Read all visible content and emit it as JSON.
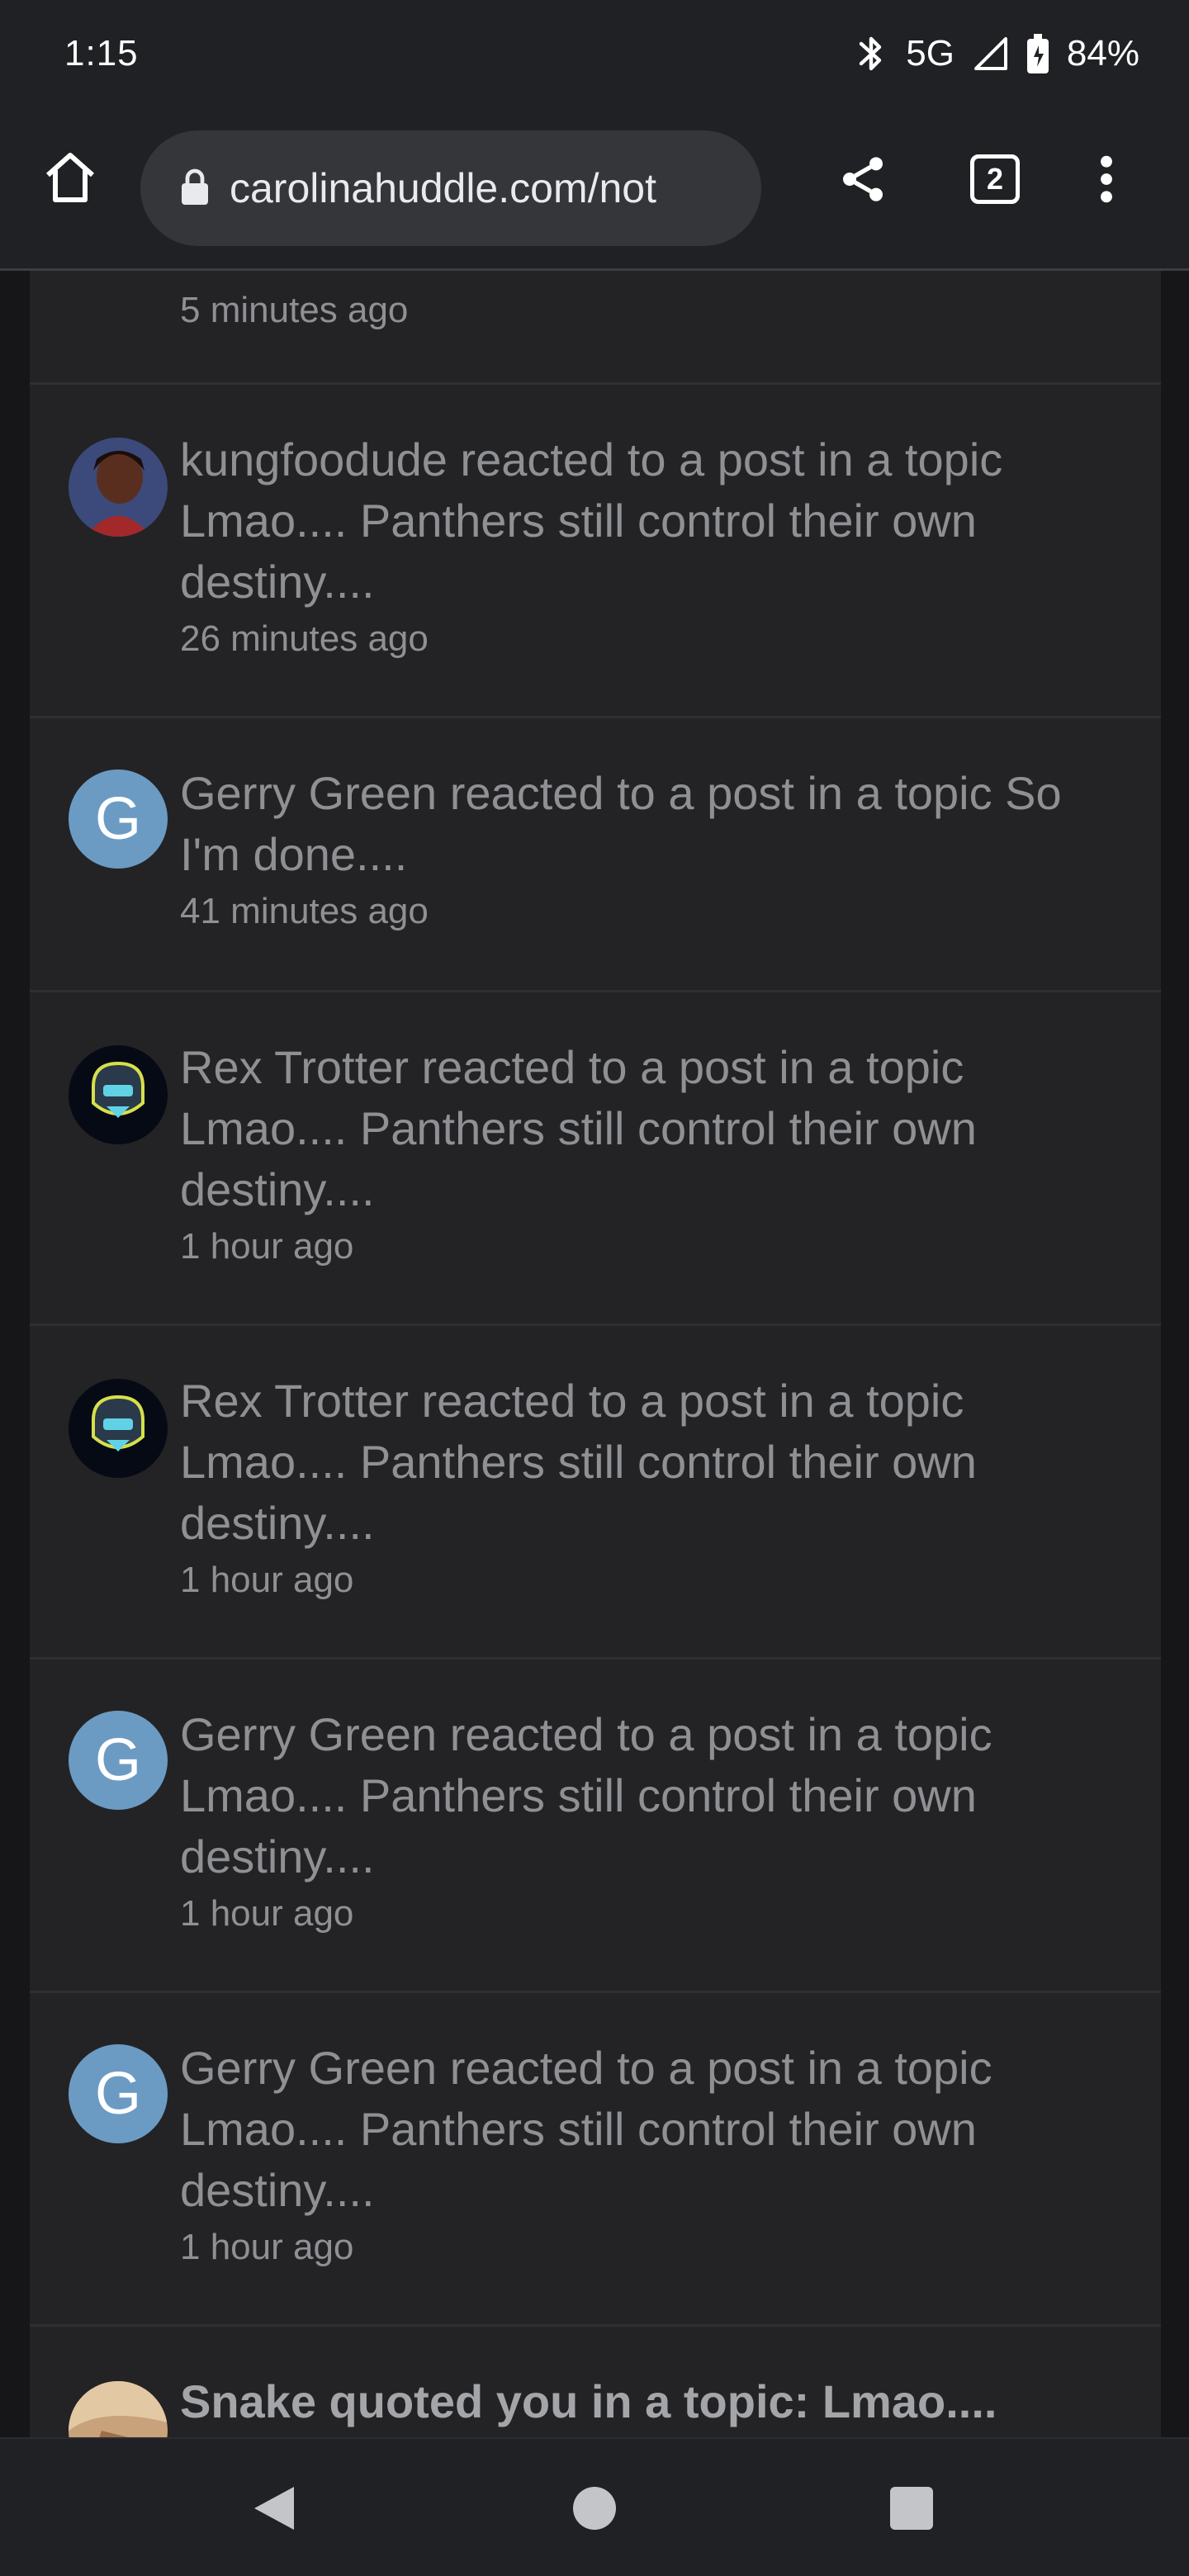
{
  "status_bar": {
    "time": "1:15",
    "network": "5G",
    "battery": "84%"
  },
  "browser": {
    "url": "carolinahuddle.com/not",
    "tab_count": "2"
  },
  "feed": {
    "first_item_time": "5 minutes ago",
    "items": [
      {
        "avatar": "photo",
        "message": "kungfoodude reacted to a post in a topic Lmao.... Panthers still control their own destiny....",
        "time": "26 minutes ago"
      },
      {
        "avatar_letter": "G",
        "message": "Gerry Green reacted to a post in a topic So I'm done....",
        "time": "41 minutes ago"
      },
      {
        "avatar": "robot-logo",
        "message": "Rex Trotter reacted to a post in a topic Lmao.... Panthers still control their own destiny....",
        "time": "1 hour ago"
      },
      {
        "avatar": "robot-logo",
        "message": "Rex Trotter reacted to a post in a topic Lmao.... Panthers still control their own destiny....",
        "time": "1 hour ago"
      },
      {
        "avatar_letter": "G",
        "message": "Gerry Green reacted to a post in a topic Lmao.... Panthers still control their own destiny....",
        "time": "1 hour ago"
      },
      {
        "avatar_letter": "G",
        "message": "Gerry Green reacted to a post in a topic Lmao.... Panthers still control their own destiny....",
        "time": "1 hour ago"
      },
      {
        "avatar": "photo",
        "message": "Snake quoted you in a topic: Lmao...."
      }
    ]
  },
  "colors": {
    "background": "#161618",
    "card": "#232325",
    "chrome": "#202124",
    "avatar_letter_bg": "#6b9bc3"
  }
}
